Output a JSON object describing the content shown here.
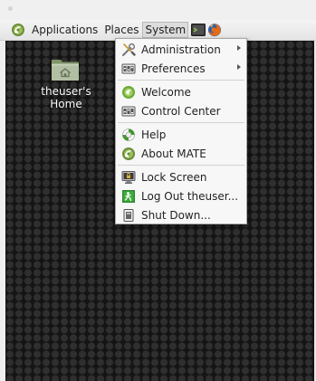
{
  "panel": {
    "applications": "Applications",
    "places": "Places",
    "system": "System"
  },
  "desktop": {
    "home_label": "theuser's Home"
  },
  "system_menu": {
    "items": [
      {
        "label": "Administration",
        "submenu": true
      },
      {
        "label": "Preferences",
        "submenu": true
      },
      {
        "label": "Welcome"
      },
      {
        "label": "Control Center"
      },
      {
        "label": "Help"
      },
      {
        "label": "About MATE"
      },
      {
        "label": "Lock Screen"
      },
      {
        "label": "Log Out theuser..."
      },
      {
        "label": "Shut Down..."
      }
    ]
  },
  "colors": {
    "desktop_bg": "#141414",
    "mate_green": "#87a556",
    "panel_bg": "#ececec"
  }
}
